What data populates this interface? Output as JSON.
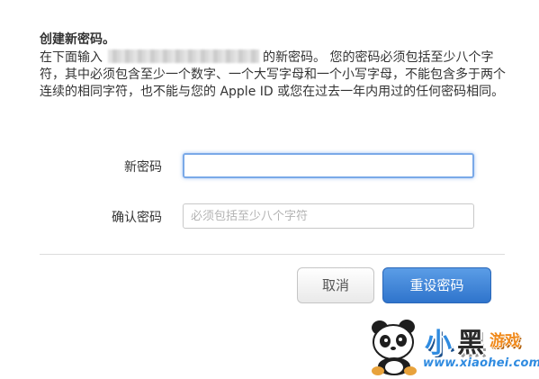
{
  "dialog": {
    "heading": "创建新密码。",
    "instructions_prefix": "在下面输入",
    "instructions_suffix": "的新密码。 您的密码必须包括至少八个字符，其中必须包含至少一个数字、一个大写字母和一个小写字母，不能包含多于两个连续的相同字符，也不能与您的 Apple ID 或您在过去一年内用过的任何密码相同。"
  },
  "form": {
    "new_password_label": "新密码",
    "new_password_value": "",
    "confirm_password_label": "确认密码",
    "confirm_password_placeholder": "必须包括至少八个字符",
    "confirm_password_value": ""
  },
  "buttons": {
    "cancel_label": "取消",
    "reset_label": "重设密码"
  },
  "watermark": {
    "char1": "小",
    "char2": "黑",
    "char3": "游戏",
    "url": "www.xiaohei.com"
  },
  "colors": {
    "primary_button": "#3a82d8",
    "focus_ring": "#7aa9e8"
  }
}
